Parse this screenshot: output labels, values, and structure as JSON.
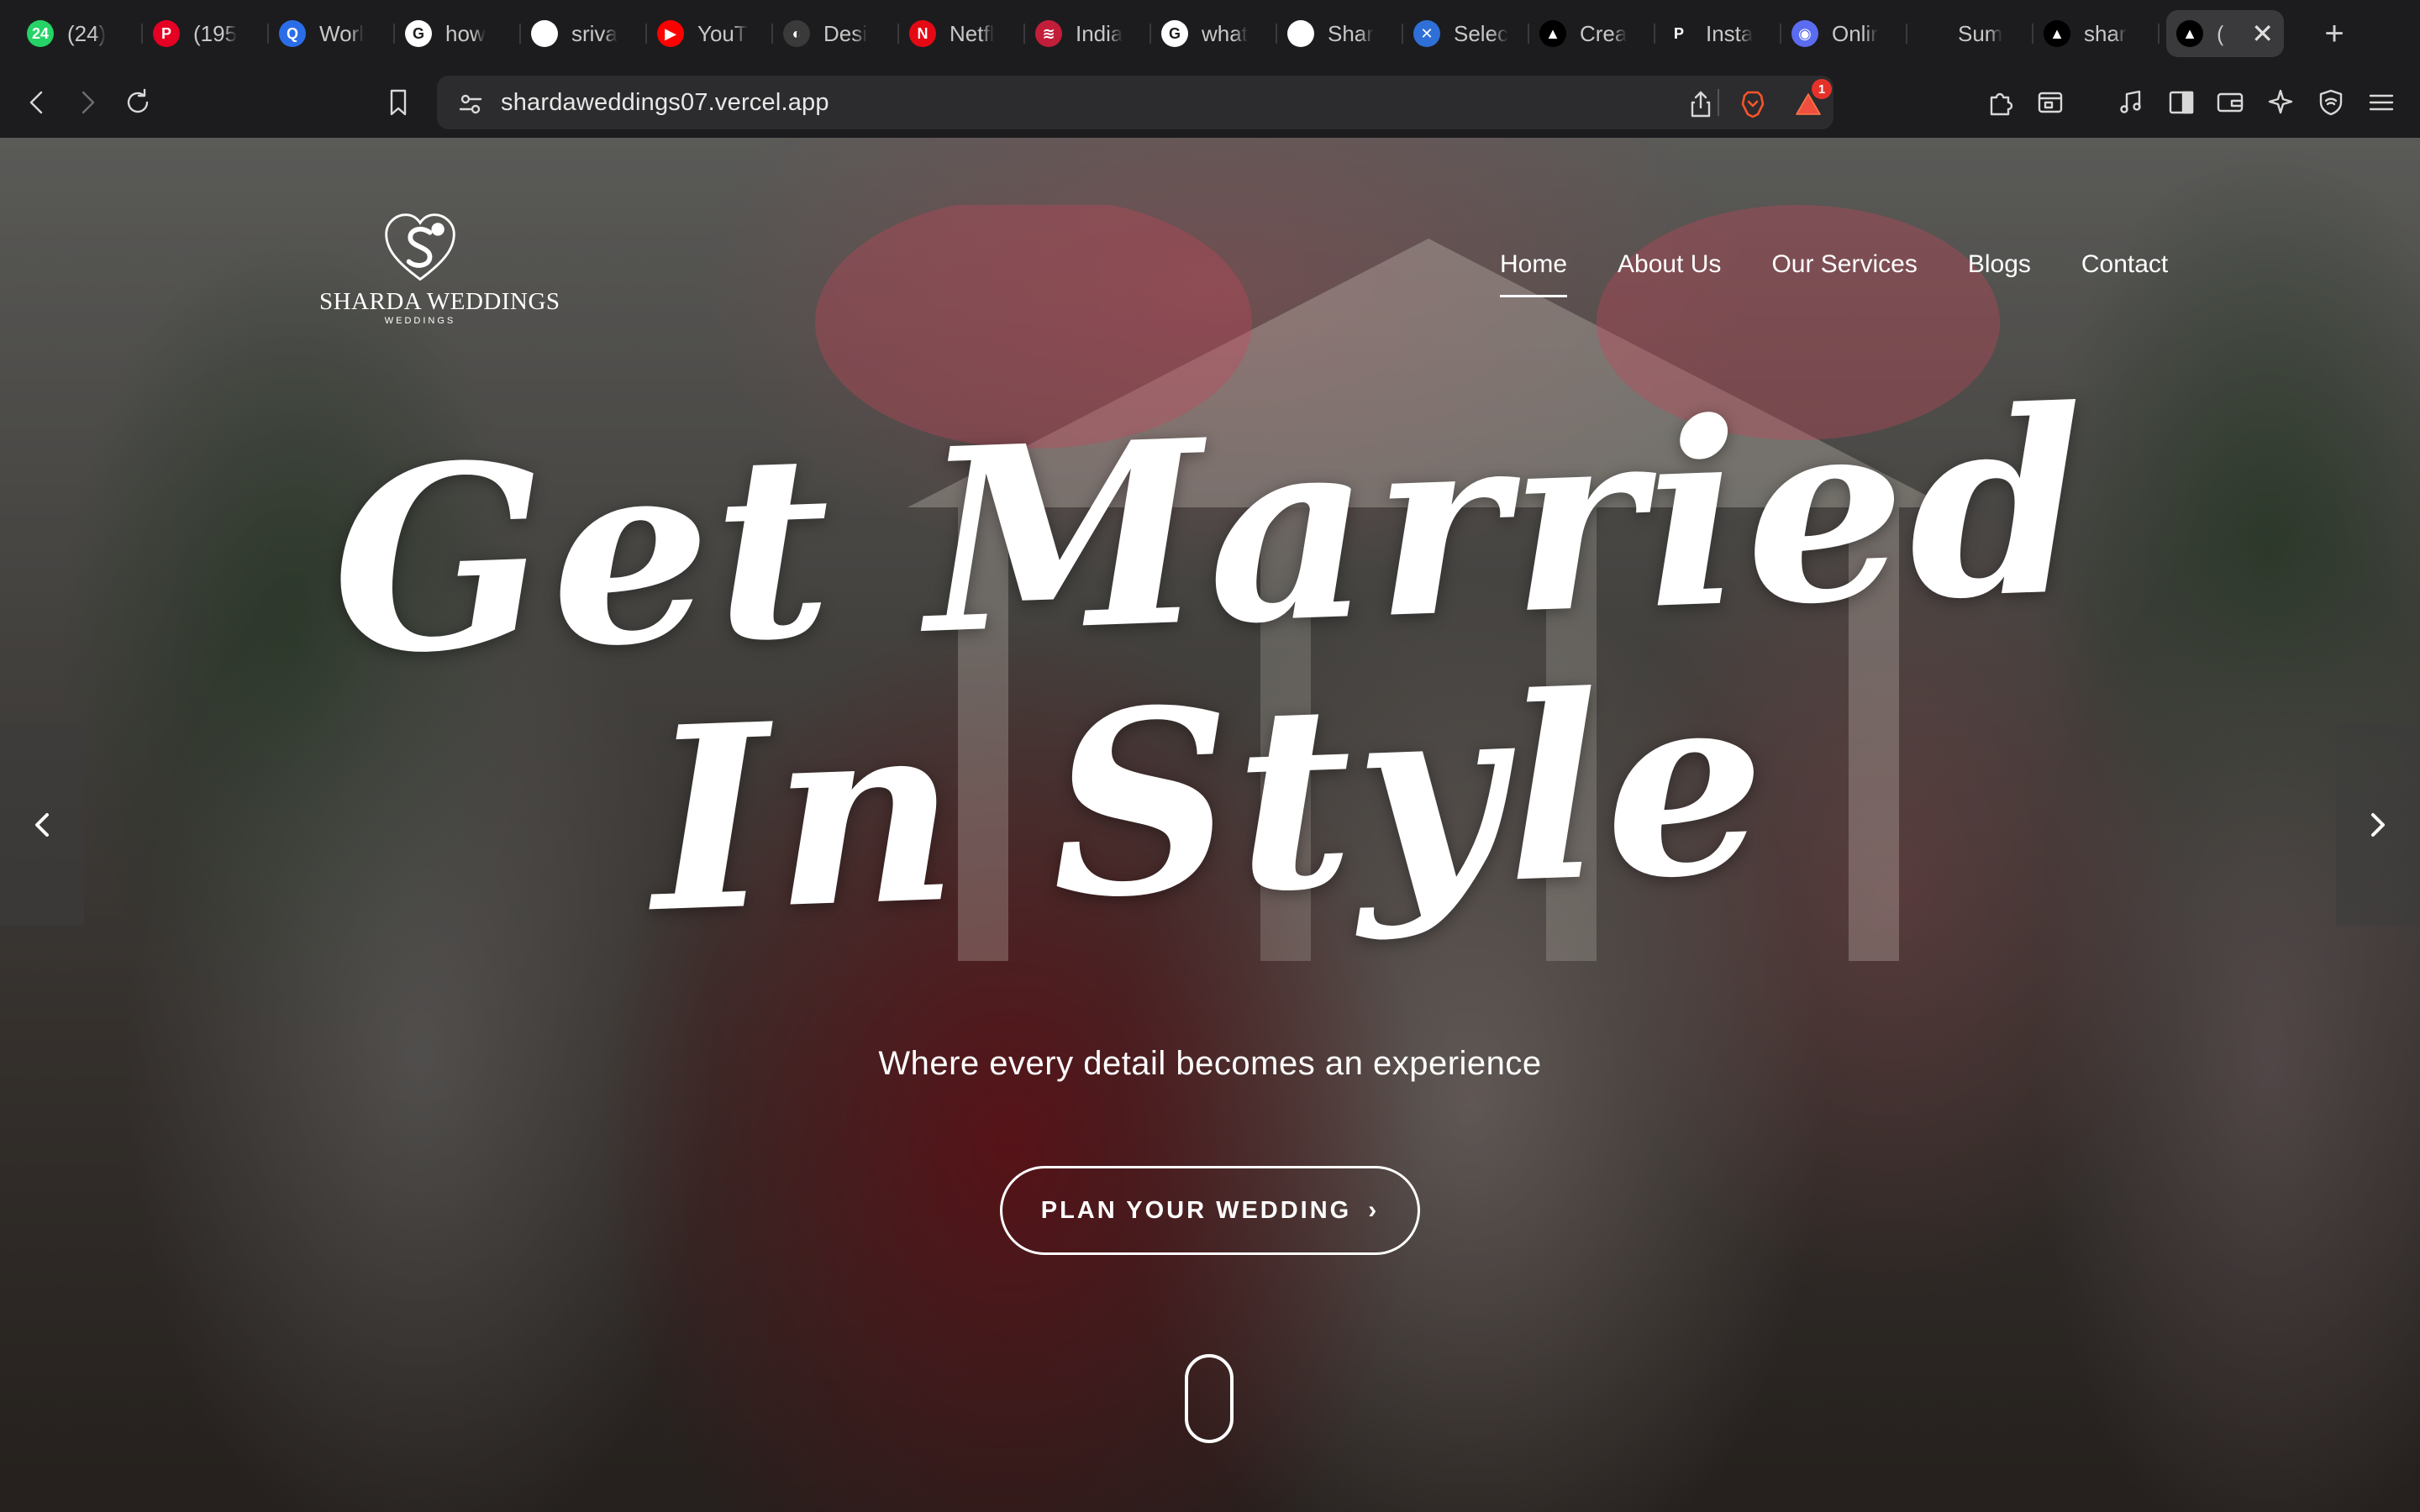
{
  "browser": {
    "tabs": [
      {
        "label": "(24)",
        "favicon_text": "24",
        "favicon_color": "#25d366",
        "icon": "whatsapp-icon"
      },
      {
        "label": "(195",
        "favicon_text": "P",
        "favicon_color": "#e60023",
        "icon": "pinterest-icon"
      },
      {
        "label": "Worl",
        "favicon_text": "Q",
        "favicon_color": "#2b6de8",
        "icon": "search-icon"
      },
      {
        "label": "how",
        "favicon_text": "G",
        "favicon_color": "#ffffff",
        "icon": "google-icon"
      },
      {
        "label": "sriva",
        "favicon_text": "",
        "favicon_color": "#ffffff",
        "icon": "github-icon"
      },
      {
        "label": "YouT",
        "favicon_text": "▶",
        "favicon_color": "#ff0000",
        "icon": "youtube-icon"
      },
      {
        "label": "Desi",
        "favicon_text": "◐",
        "favicon_color": "#3a3a3a",
        "icon": "design-icon"
      },
      {
        "label": "Netfl",
        "favicon_text": "N",
        "favicon_color": "#e50914",
        "icon": "netflix-icon"
      },
      {
        "label": "India",
        "favicon_text": "≋",
        "favicon_color": "#c21e3a",
        "icon": "india-icon"
      },
      {
        "label": "what",
        "favicon_text": "G",
        "favicon_color": "#ffffff",
        "icon": "google-icon"
      },
      {
        "label": "Shar",
        "favicon_text": "",
        "favicon_color": "#ffffff",
        "icon": "github-icon"
      },
      {
        "label": "Selec",
        "favicon_text": "✕",
        "favicon_color": "#2f6fd8",
        "icon": "zoho-icon"
      },
      {
        "label": "Crea",
        "favicon_text": "▲",
        "favicon_color": "#000000",
        "icon": "vercel-icon"
      },
      {
        "label": "Insta",
        "favicon_text": "P",
        "favicon_color": "#1c1c1e",
        "icon": "insta-icon"
      },
      {
        "label": "Onlir",
        "favicon_text": "◉",
        "favicon_color": "#5b6cf0",
        "icon": "online-icon"
      },
      {
        "label": "Sum",
        "favicon_text": "",
        "favicon_color": "#1c1c1e",
        "icon": "blank-icon"
      },
      {
        "label": "shar",
        "favicon_text": "▲",
        "favicon_color": "#000000",
        "icon": "vercel-icon"
      }
    ],
    "active_tab": {
      "label": "(",
      "favicon_text": "▲",
      "favicon_color": "#000000",
      "icon": "vercel-icon"
    },
    "close_glyph": "✕",
    "new_tab_glyph": "+",
    "url": "shardaweddings07.vercel.app",
    "shields_badge": "1"
  },
  "site": {
    "logo": {
      "name": "SHARDA WEDDINGS",
      "sub": "WEDDINGS"
    },
    "nav": [
      {
        "label": "Home",
        "active": true
      },
      {
        "label": "About Us",
        "active": false
      },
      {
        "label": "Our Services",
        "active": false
      },
      {
        "label": "Blogs",
        "active": false
      },
      {
        "label": "Contact",
        "active": false
      }
    ],
    "headline_line1": "Get Married",
    "headline_line2": "In Style",
    "tagline": "Where every detail becomes an experience",
    "cta_label": "PLAN YOUR WEDDING",
    "cta_chevron": "›"
  },
  "colors": {
    "chrome_bg": "#1c1c1e",
    "omnibox_bg": "#2c2c2e",
    "text_white": "#ffffff",
    "badge_red": "#e4322b"
  }
}
